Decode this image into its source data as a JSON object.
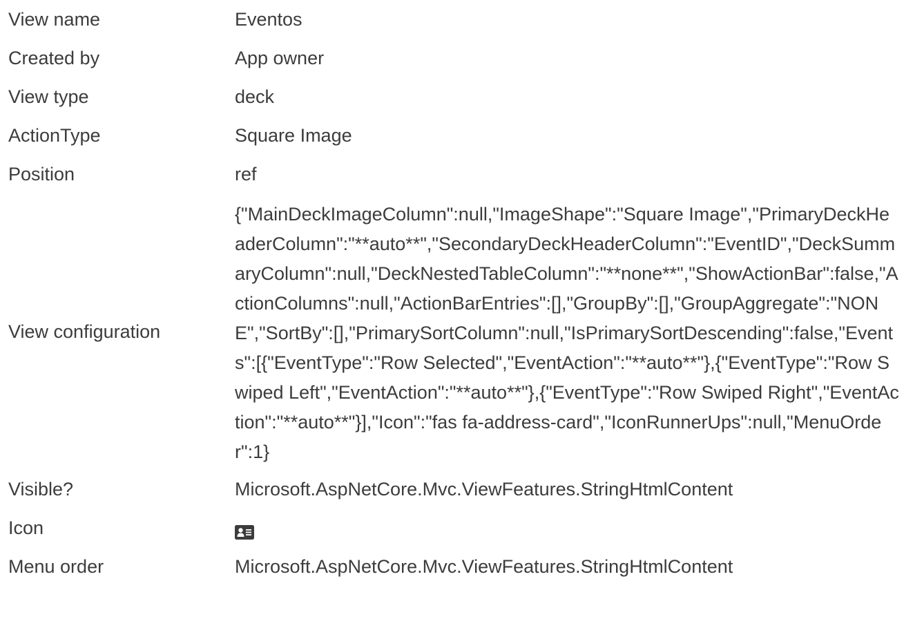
{
  "rows": [
    {
      "label": "View name",
      "value": "Eventos"
    },
    {
      "label": "Created by",
      "value": "App owner"
    },
    {
      "label": "View type",
      "value": "deck"
    },
    {
      "label": "ActionType",
      "value": "Square Image"
    },
    {
      "label": "Position",
      "value": "ref"
    },
    {
      "label": "View configuration",
      "value": "{\"MainDeckImageColumn\":null,\"ImageShape\":\"Square Image\",\"PrimaryDeckHeaderColumn\":\"**auto**\",\"SecondaryDeckHeaderColumn\":\"EventID\",\"DeckSummaryColumn\":null,\"DeckNestedTableColumn\":\"**none**\",\"ShowActionBar\":false,\"ActionColumns\":null,\"ActionBarEntries\":[],\"GroupBy\":[],\"GroupAggregate\":\"NONE\",\"SortBy\":[],\"PrimarySortColumn\":null,\"IsPrimarySortDescending\":false,\"Events\":[{\"EventType\":\"Row Selected\",\"EventAction\":\"**auto**\"},{\"EventType\":\"Row Swiped Left\",\"EventAction\":\"**auto**\"},{\"EventType\":\"Row Swiped Right\",\"EventAction\":\"**auto**\"}],\"Icon\":\"fas fa-address-card\",\"IconRunnerUps\":null,\"MenuOrder\":1}"
    },
    {
      "label": "Visible?",
      "value": "Microsoft.AspNetCore.Mvc.ViewFeatures.StringHtmlContent"
    },
    {
      "label": "Icon",
      "icon": "address-card-icon"
    },
    {
      "label": "Menu order",
      "value": "Microsoft.AspNetCore.Mvc.ViewFeatures.StringHtmlContent"
    }
  ],
  "colors": {
    "text": "#3c3c3c",
    "icon": "#3c3c3c",
    "background": "#ffffff"
  }
}
